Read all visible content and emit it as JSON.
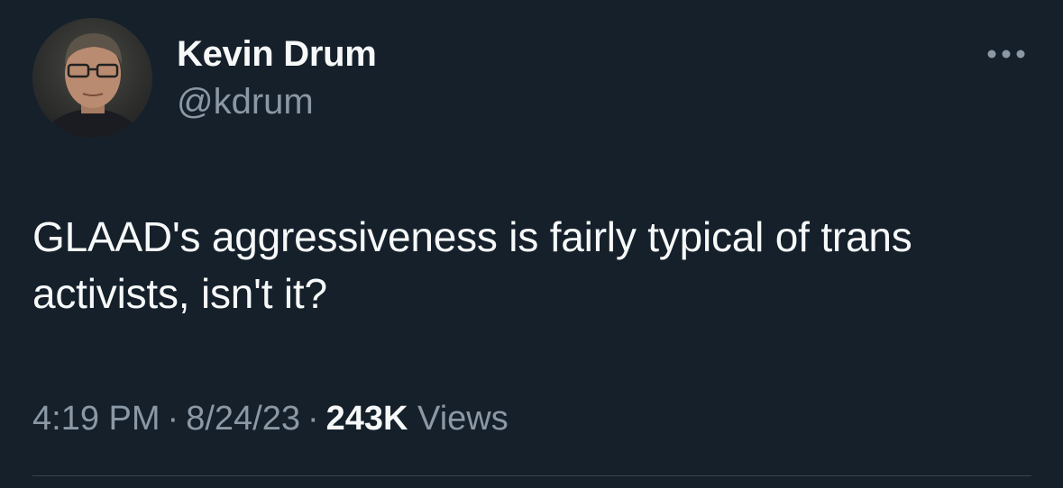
{
  "author": {
    "display_name": "Kevin Drum",
    "handle": "@kdrum",
    "avatar_icon": "profile-photo"
  },
  "more_icon": "ellipsis-icon",
  "tweet": {
    "text": "GLAAD's aggressiveness is fairly typical of trans activists, isn't it?"
  },
  "meta": {
    "time": "4:19 PM",
    "separator": "·",
    "date": "8/24/23",
    "views_count": "243K",
    "views_label": "Views"
  },
  "colors": {
    "background": "#15202b",
    "primary_text": "#f7f9f9",
    "secondary_text": "#8b98a5",
    "divider": "#38444d"
  }
}
